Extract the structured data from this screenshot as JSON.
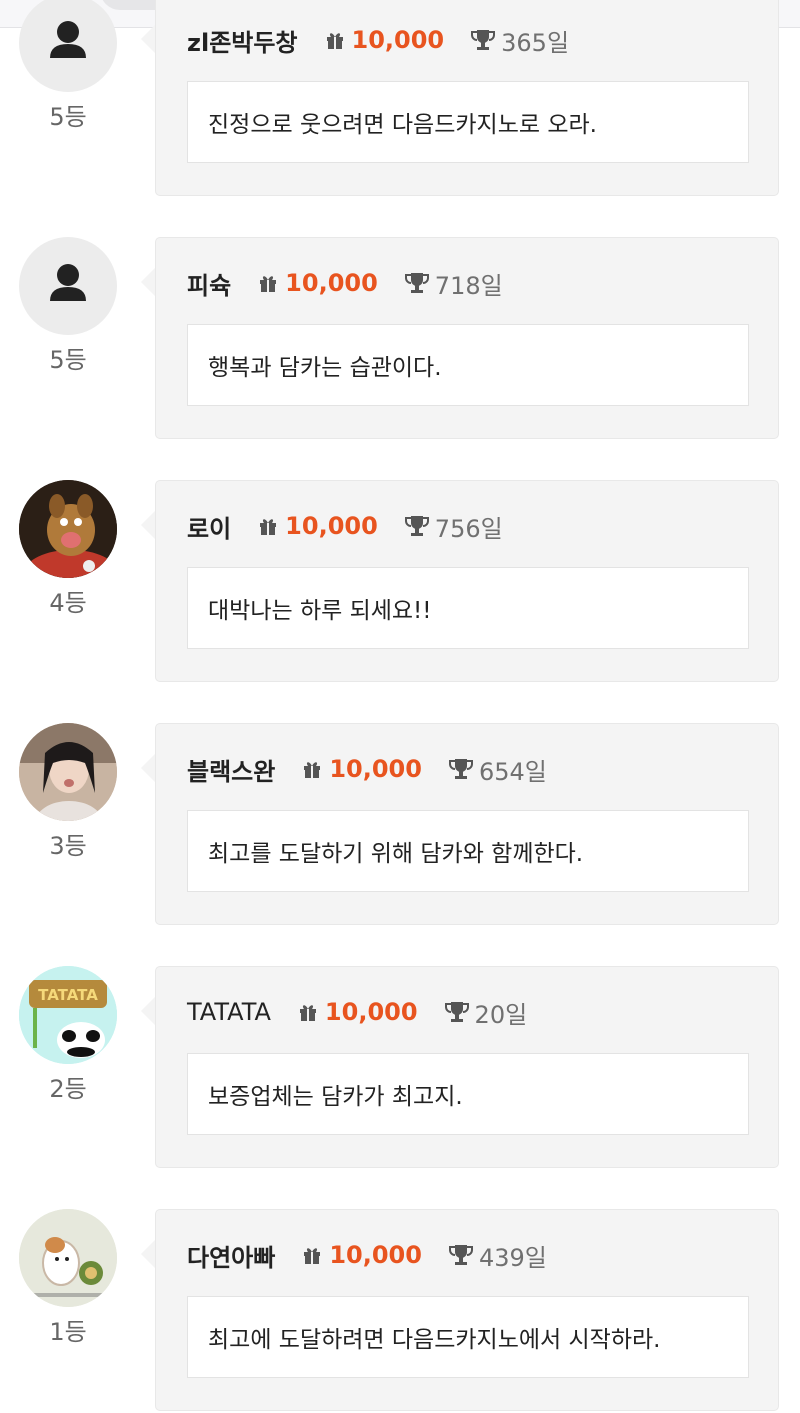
{
  "colors": {
    "accent": "#e8541f",
    "panel": "#f4f4f4",
    "text": "#222222",
    "muted": "#707070"
  },
  "icons": {
    "gift": "gift-icon",
    "trophy": "trophy-icon",
    "default_avatar": "user-silhouette-icon"
  },
  "entries": [
    {
      "rank": "5등",
      "nickname": "zl존박두창",
      "points": "10,000",
      "days": "365일",
      "message": "진정으로 웃으려면 다음드카지노로 오라.",
      "avatar": "default"
    },
    {
      "rank": "5등",
      "nickname": "피슉",
      "points": "10,000",
      "days": "718일",
      "message": "행복과 담카는 습관이다.",
      "avatar": "default"
    },
    {
      "rank": "4등",
      "nickname": "로이",
      "points": "10,000",
      "days": "756일",
      "message": "대박나는 하루 되세요!!",
      "avatar": "cartoon-dog"
    },
    {
      "rank": "3등",
      "nickname": "블랙스완",
      "points": "10,000",
      "days": "654일",
      "message": "최고를 도달하기 위해 담카와 함께한다.",
      "avatar": "photo-woman"
    },
    {
      "rank": "2등",
      "nickname": "TATATA",
      "points": "10,000",
      "days": "20일",
      "message": "보증업체는 담카가 최고지.",
      "avatar": "panda-sign",
      "avatar_text": "TATATA"
    },
    {
      "rank": "1등",
      "nickname": "다연아빠",
      "points": "10,000",
      "days": "439일",
      "message": "최고에 도달하려면 다음드카지노에서 시작하라.",
      "avatar": "hamster"
    }
  ]
}
